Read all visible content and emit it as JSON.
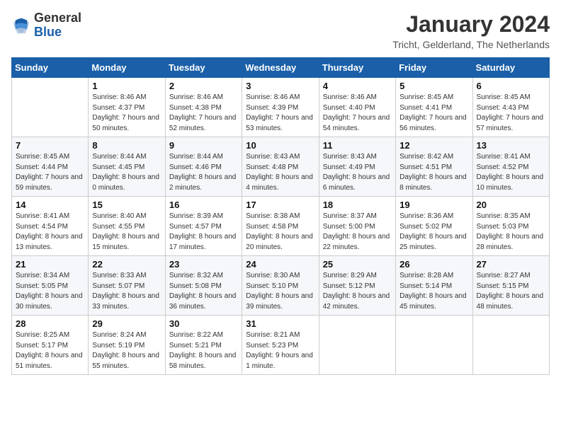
{
  "header": {
    "logo_general": "General",
    "logo_blue": "Blue",
    "month": "January 2024",
    "location": "Tricht, Gelderland, The Netherlands"
  },
  "weekdays": [
    "Sunday",
    "Monday",
    "Tuesday",
    "Wednesday",
    "Thursday",
    "Friday",
    "Saturday"
  ],
  "weeks": [
    [
      {
        "day": "",
        "sunrise": "",
        "sunset": "",
        "daylight": ""
      },
      {
        "day": "1",
        "sunrise": "Sunrise: 8:46 AM",
        "sunset": "Sunset: 4:37 PM",
        "daylight": "Daylight: 7 hours and 50 minutes."
      },
      {
        "day": "2",
        "sunrise": "Sunrise: 8:46 AM",
        "sunset": "Sunset: 4:38 PM",
        "daylight": "Daylight: 7 hours and 52 minutes."
      },
      {
        "day": "3",
        "sunrise": "Sunrise: 8:46 AM",
        "sunset": "Sunset: 4:39 PM",
        "daylight": "Daylight: 7 hours and 53 minutes."
      },
      {
        "day": "4",
        "sunrise": "Sunrise: 8:46 AM",
        "sunset": "Sunset: 4:40 PM",
        "daylight": "Daylight: 7 hours and 54 minutes."
      },
      {
        "day": "5",
        "sunrise": "Sunrise: 8:45 AM",
        "sunset": "Sunset: 4:41 PM",
        "daylight": "Daylight: 7 hours and 56 minutes."
      },
      {
        "day": "6",
        "sunrise": "Sunrise: 8:45 AM",
        "sunset": "Sunset: 4:43 PM",
        "daylight": "Daylight: 7 hours and 57 minutes."
      }
    ],
    [
      {
        "day": "7",
        "sunrise": "Sunrise: 8:45 AM",
        "sunset": "Sunset: 4:44 PM",
        "daylight": "Daylight: 7 hours and 59 minutes."
      },
      {
        "day": "8",
        "sunrise": "Sunrise: 8:44 AM",
        "sunset": "Sunset: 4:45 PM",
        "daylight": "Daylight: 8 hours and 0 minutes."
      },
      {
        "day": "9",
        "sunrise": "Sunrise: 8:44 AM",
        "sunset": "Sunset: 4:46 PM",
        "daylight": "Daylight: 8 hours and 2 minutes."
      },
      {
        "day": "10",
        "sunrise": "Sunrise: 8:43 AM",
        "sunset": "Sunset: 4:48 PM",
        "daylight": "Daylight: 8 hours and 4 minutes."
      },
      {
        "day": "11",
        "sunrise": "Sunrise: 8:43 AM",
        "sunset": "Sunset: 4:49 PM",
        "daylight": "Daylight: 8 hours and 6 minutes."
      },
      {
        "day": "12",
        "sunrise": "Sunrise: 8:42 AM",
        "sunset": "Sunset: 4:51 PM",
        "daylight": "Daylight: 8 hours and 8 minutes."
      },
      {
        "day": "13",
        "sunrise": "Sunrise: 8:41 AM",
        "sunset": "Sunset: 4:52 PM",
        "daylight": "Daylight: 8 hours and 10 minutes."
      }
    ],
    [
      {
        "day": "14",
        "sunrise": "Sunrise: 8:41 AM",
        "sunset": "Sunset: 4:54 PM",
        "daylight": "Daylight: 8 hours and 13 minutes."
      },
      {
        "day": "15",
        "sunrise": "Sunrise: 8:40 AM",
        "sunset": "Sunset: 4:55 PM",
        "daylight": "Daylight: 8 hours and 15 minutes."
      },
      {
        "day": "16",
        "sunrise": "Sunrise: 8:39 AM",
        "sunset": "Sunset: 4:57 PM",
        "daylight": "Daylight: 8 hours and 17 minutes."
      },
      {
        "day": "17",
        "sunrise": "Sunrise: 8:38 AM",
        "sunset": "Sunset: 4:58 PM",
        "daylight": "Daylight: 8 hours and 20 minutes."
      },
      {
        "day": "18",
        "sunrise": "Sunrise: 8:37 AM",
        "sunset": "Sunset: 5:00 PM",
        "daylight": "Daylight: 8 hours and 22 minutes."
      },
      {
        "day": "19",
        "sunrise": "Sunrise: 8:36 AM",
        "sunset": "Sunset: 5:02 PM",
        "daylight": "Daylight: 8 hours and 25 minutes."
      },
      {
        "day": "20",
        "sunrise": "Sunrise: 8:35 AM",
        "sunset": "Sunset: 5:03 PM",
        "daylight": "Daylight: 8 hours and 28 minutes."
      }
    ],
    [
      {
        "day": "21",
        "sunrise": "Sunrise: 8:34 AM",
        "sunset": "Sunset: 5:05 PM",
        "daylight": "Daylight: 8 hours and 30 minutes."
      },
      {
        "day": "22",
        "sunrise": "Sunrise: 8:33 AM",
        "sunset": "Sunset: 5:07 PM",
        "daylight": "Daylight: 8 hours and 33 minutes."
      },
      {
        "day": "23",
        "sunrise": "Sunrise: 8:32 AM",
        "sunset": "Sunset: 5:08 PM",
        "daylight": "Daylight: 8 hours and 36 minutes."
      },
      {
        "day": "24",
        "sunrise": "Sunrise: 8:30 AM",
        "sunset": "Sunset: 5:10 PM",
        "daylight": "Daylight: 8 hours and 39 minutes."
      },
      {
        "day": "25",
        "sunrise": "Sunrise: 8:29 AM",
        "sunset": "Sunset: 5:12 PM",
        "daylight": "Daylight: 8 hours and 42 minutes."
      },
      {
        "day": "26",
        "sunrise": "Sunrise: 8:28 AM",
        "sunset": "Sunset: 5:14 PM",
        "daylight": "Daylight: 8 hours and 45 minutes."
      },
      {
        "day": "27",
        "sunrise": "Sunrise: 8:27 AM",
        "sunset": "Sunset: 5:15 PM",
        "daylight": "Daylight: 8 hours and 48 minutes."
      }
    ],
    [
      {
        "day": "28",
        "sunrise": "Sunrise: 8:25 AM",
        "sunset": "Sunset: 5:17 PM",
        "daylight": "Daylight: 8 hours and 51 minutes."
      },
      {
        "day": "29",
        "sunrise": "Sunrise: 8:24 AM",
        "sunset": "Sunset: 5:19 PM",
        "daylight": "Daylight: 8 hours and 55 minutes."
      },
      {
        "day": "30",
        "sunrise": "Sunrise: 8:22 AM",
        "sunset": "Sunset: 5:21 PM",
        "daylight": "Daylight: 8 hours and 58 minutes."
      },
      {
        "day": "31",
        "sunrise": "Sunrise: 8:21 AM",
        "sunset": "Sunset: 5:23 PM",
        "daylight": "Daylight: 9 hours and 1 minute."
      },
      {
        "day": "",
        "sunrise": "",
        "sunset": "",
        "daylight": ""
      },
      {
        "day": "",
        "sunrise": "",
        "sunset": "",
        "daylight": ""
      },
      {
        "day": "",
        "sunrise": "",
        "sunset": "",
        "daylight": ""
      }
    ]
  ]
}
